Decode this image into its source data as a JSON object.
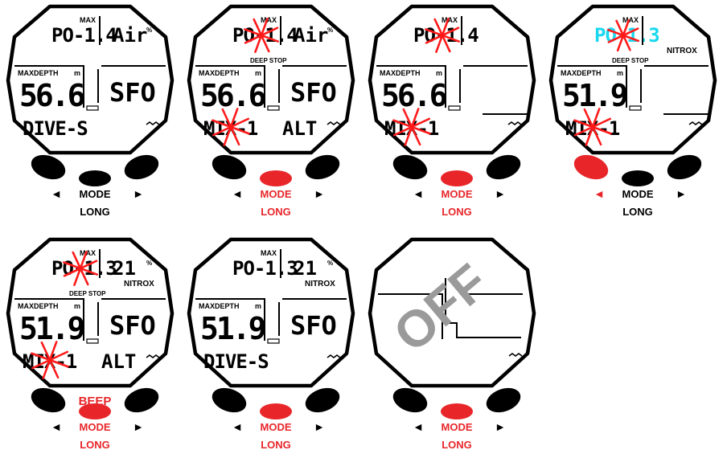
{
  "colors": {
    "ink": "#000000",
    "active": "#e8262a",
    "flash": "#ff1a1a",
    "cyan": "#19d8f0",
    "watermark": "#9a9a9a"
  },
  "labels": {
    "max": "MAX",
    "maxdepth": "MAXDEPTH",
    "unit_m": "m",
    "deep_stop": "DEEP STOP",
    "nitrox": "NITROX",
    "mode": "MODE",
    "long": "LONG",
    "beep": "BEEP",
    "off": "OFF",
    "pct": "%",
    "left_arrow": "◄",
    "right_arrow": "►"
  },
  "screens": [
    {
      "po": "PO-1.4",
      "gas": "Air",
      "depth": "56.6",
      "sfo": "SFO",
      "mode": "DIVE-S",
      "alt": "",
      "active_button": "none",
      "active_label": "none",
      "deep_stop": false,
      "nitrox_tag": false
    },
    {
      "po": "PO-1.4",
      "gas": "Air",
      "depth": "56.6",
      "sfo": "SFO",
      "mode": "MIX-1",
      "alt": "ALT",
      "active_button": "center",
      "active_label": "mode",
      "deep_stop": true,
      "nitrox_tag": false
    },
    {
      "po": "PO-1.4",
      "gas": "",
      "depth": "56.6",
      "sfo": "",
      "mode": "MIX-1",
      "alt": "",
      "active_button": "center",
      "active_label": "mode",
      "deep_stop": false,
      "nitrox_tag": false
    },
    {
      "po": "PO-1.3",
      "gas": "",
      "depth": "51.9",
      "sfo": "",
      "mode": "MIX-1",
      "alt": "",
      "active_button": "left",
      "active_label": "left",
      "deep_stop": true,
      "nitrox_tag": true
    },
    {
      "po": "PO-1.3",
      "gas": "21",
      "depth": "51.9",
      "sfo": "SFO",
      "mode": "MIX-1",
      "alt": "ALT",
      "active_button": "center",
      "active_label": "mode",
      "deep_stop": true,
      "nitrox_tag": true,
      "beep": true
    },
    {
      "po": "PO-1.3",
      "gas": "21",
      "depth": "51.9",
      "sfo": "SFO",
      "mode": "DIVE-S",
      "alt": "",
      "active_button": "center",
      "active_label": "mode",
      "deep_stop": false,
      "nitrox_tag": true
    },
    {
      "po": "",
      "gas": "",
      "depth": "",
      "sfo": "",
      "mode": "",
      "alt": "",
      "active_button": "center",
      "active_label": "mode",
      "deep_stop": false,
      "nitrox_tag": false,
      "off": true
    }
  ]
}
